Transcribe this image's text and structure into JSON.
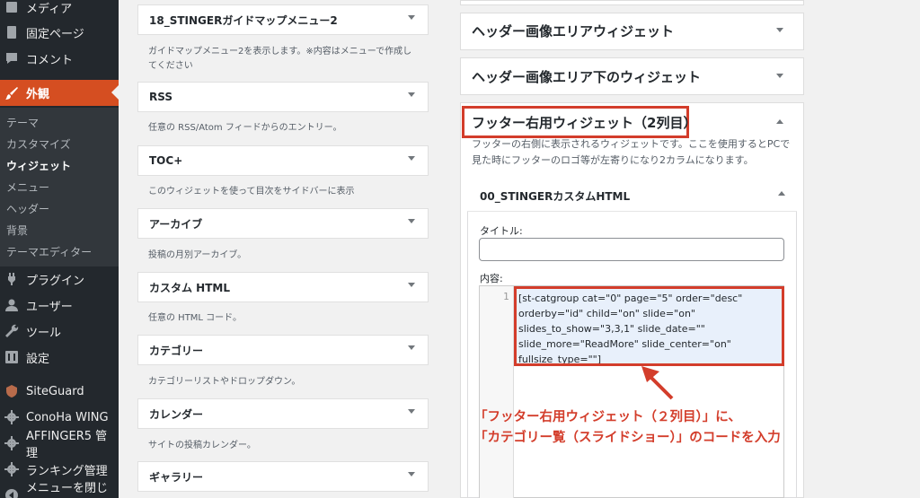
{
  "sidebar": {
    "items": [
      {
        "label": "メディア",
        "icon": "media-icon"
      },
      {
        "label": "固定ページ",
        "icon": "page-icon"
      },
      {
        "label": "コメント",
        "icon": "comment-icon"
      },
      {
        "label": "外観",
        "icon": "brush-icon"
      },
      {
        "label": "プラグイン",
        "icon": "plugin-icon"
      },
      {
        "label": "ユーザー",
        "icon": "user-icon"
      },
      {
        "label": "ツール",
        "icon": "wrench-icon"
      },
      {
        "label": "設定",
        "icon": "settings-icon"
      },
      {
        "label": "SiteGuard",
        "icon": "siteguard-icon"
      },
      {
        "label": "ConoHa WING",
        "icon": "gear-icon"
      },
      {
        "label": "AFFINGER5 管理",
        "icon": "gear-icon"
      },
      {
        "label": "ランキング管理",
        "icon": "gear-icon"
      },
      {
        "label": "メニューを閉じる",
        "icon": "collapse-icon"
      }
    ],
    "submenu": [
      "テーマ",
      "カスタマイズ",
      "ウィジェット",
      "メニュー",
      "ヘッダー",
      "背景",
      "テーマエディター"
    ]
  },
  "widgets": [
    {
      "title": "18_STINGERガイドマップメニュー2",
      "desc": "ガイドマップメニュー2を表示します。※内容はメニューで作成してください"
    },
    {
      "title": "RSS",
      "desc": "任意の RSS/Atom フィードからのエントリー。"
    },
    {
      "title": "TOC+",
      "desc": "このウィジェットを使って目次をサイドバーに表示"
    },
    {
      "title": "アーカイブ",
      "desc": "投稿の月別アーカイブ。"
    },
    {
      "title": "カスタム HTML",
      "desc": "任意の HTML コード。"
    },
    {
      "title": "カテゴリー",
      "desc": "カテゴリーリストやドロップダウン。"
    },
    {
      "title": "カレンダー",
      "desc": "サイトの投稿カレンダー。"
    },
    {
      "title": "ギャラリー",
      "desc": ""
    }
  ],
  "areas": {
    "header_image": "ヘッダー画像エリアウィジェット",
    "below_header": "ヘッダー画像エリア下のウィジェット",
    "footer_right": "フッター右用ウィジェット（2列目）",
    "footer_right_desc": "フッターの右側に表示されるウィジェットです。ここを使用するとPCで見た時にフッターのロゴ等が左寄りになり2カラムになります。"
  },
  "inner_widget": {
    "title": "00_STINGERカスタムHTML",
    "title_label": "タイトル:",
    "title_value": "",
    "content_label": "内容:",
    "line_number": "1",
    "code": "[st-catgroup cat=\"0\" page=\"5\" order=\"desc\" orderby=\"id\" child=\"on\" slide=\"on\" slides_to_show=\"3,3,1\" slide_date=\"\" slide_more=\"ReadMore\" slide_center=\"on\" fullsize_type=\"\"]"
  },
  "annotation": {
    "line1": "「フッター右用ウィジェット（２列目）」に、",
    "line2": "「カテゴリー覧（スライドショー）」のコードを入力"
  },
  "colors": {
    "sidebar_bg": "#23282d",
    "accent": "#d54e21",
    "annotation": "#d33d2b"
  }
}
